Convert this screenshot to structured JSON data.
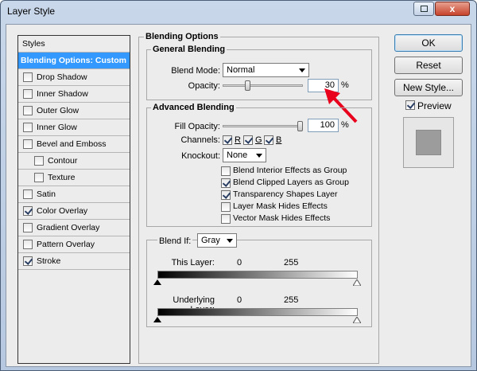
{
  "window": {
    "title": "Layer Style",
    "close_label": "x"
  },
  "styles": {
    "header": "Styles",
    "items": [
      {
        "label": "Blending Options: Custom",
        "selected": true
      },
      {
        "label": "Drop Shadow",
        "checked": false
      },
      {
        "label": "Inner Shadow",
        "checked": false
      },
      {
        "label": "Outer Glow",
        "checked": false
      },
      {
        "label": "Inner Glow",
        "checked": false
      },
      {
        "label": "Bevel and Emboss",
        "checked": false
      },
      {
        "label": "Contour",
        "checked": false,
        "indent": true
      },
      {
        "label": "Texture",
        "checked": false,
        "indent": true
      },
      {
        "label": "Satin",
        "checked": false
      },
      {
        "label": "Color Overlay",
        "checked": true
      },
      {
        "label": "Gradient Overlay",
        "checked": false
      },
      {
        "label": "Pattern Overlay",
        "checked": false
      },
      {
        "label": "Stroke",
        "checked": true
      }
    ]
  },
  "blending_options": {
    "title": "Blending Options",
    "general": {
      "title": "General Blending",
      "blend_mode_label": "Blend Mode:",
      "blend_mode_value": "Normal",
      "opacity_label": "Opacity:",
      "opacity_value": "30",
      "opacity_level": 0.3,
      "percent": "%"
    },
    "advanced": {
      "title": "Advanced Blending",
      "fill_opacity_label": "Fill Opacity:",
      "fill_opacity_value": "100",
      "fill_opacity_level": 1.0,
      "percent": "%",
      "channels_label": "Channels:",
      "channels": [
        {
          "label": "R",
          "checked": true
        },
        {
          "label": "G",
          "checked": true
        },
        {
          "label": "B",
          "checked": true
        }
      ],
      "knockout_label": "Knockout:",
      "knockout_value": "None",
      "options": [
        {
          "label": "Blend Interior Effects as Group",
          "checked": false
        },
        {
          "label": "Blend Clipped Layers as Group",
          "checked": true
        },
        {
          "label": "Transparency Shapes Layer",
          "checked": true
        },
        {
          "label": "Layer Mask Hides Effects",
          "checked": false
        },
        {
          "label": "Vector Mask Hides Effects",
          "checked": false
        }
      ]
    },
    "blend_if": {
      "label": "Blend If:",
      "value": "Gray",
      "this_layer_label": "This Layer:",
      "this_layer_min": "0",
      "this_layer_max": "255",
      "underlying_label": "Underlying Layer:",
      "underlying_min": "0",
      "underlying_max": "255"
    }
  },
  "buttons": {
    "ok": "OK",
    "reset": "Reset",
    "new_style": "New Style...",
    "preview": "Preview",
    "preview_checked": true
  },
  "colors": {
    "accent": "#3399ff",
    "annotation_arrow": "#e8001c"
  }
}
